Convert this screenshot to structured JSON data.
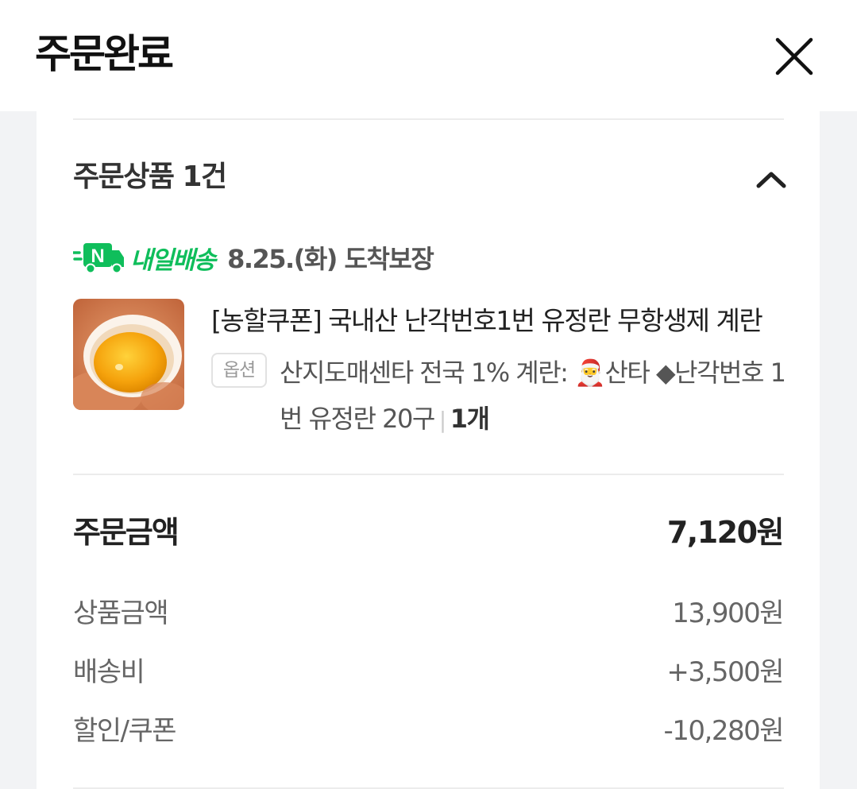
{
  "header": {
    "title": "주문완료"
  },
  "order_items": {
    "title": "주문상품 1건",
    "delivery": {
      "badge_letter": "N",
      "service_name": "내일배송",
      "arrival_text": "8.25.(화) 도착보장",
      "accent_color": "#0fbe5b"
    },
    "product": {
      "name": "[농할쿠폰] 국내산 난각번호1번 유정란 무항생제 계란",
      "option_badge": "옵션",
      "option_text": "산지도매센타 전국 1% 계란: 🎅산타 ◆난각번호 1번 유정란 20구",
      "quantity": "1개"
    }
  },
  "order_amount": {
    "label": "주문금액",
    "total": "7,120원",
    "rows": [
      {
        "label": "상품금액",
        "value": "13,900원"
      },
      {
        "label": "배송비",
        "value": "+3,500원"
      },
      {
        "label": "할인/쿠폰",
        "value": "-10,280원"
      }
    ]
  }
}
